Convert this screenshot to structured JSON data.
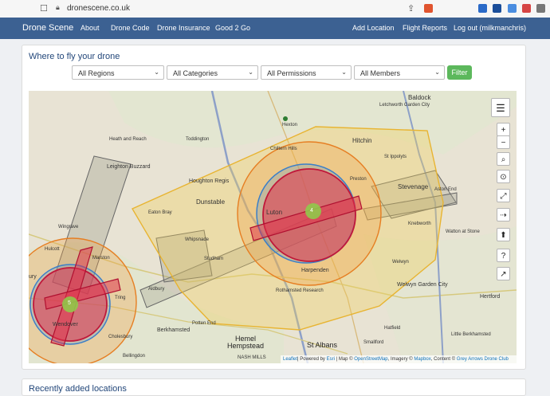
{
  "browser": {
    "url": "dronescene.co.uk",
    "icons": [
      "bookmark-icon",
      "lock-icon",
      "share-icon",
      "brave-shield-icon"
    ]
  },
  "nav": {
    "brand": "Drone Scene",
    "left_items": [
      "About",
      "Drone Code",
      "Drone Insurance",
      "Good 2 Go"
    ],
    "right_items": [
      "Add Location",
      "Flight Reports",
      "Log out (milkmanchris)"
    ],
    "bg_color": "#3c6192"
  },
  "page": {
    "title": "Where to fly your drone",
    "filters": {
      "regions": "All Regions",
      "categories": "All Categories",
      "permissions": "All Permissions",
      "members": "All Members",
      "button": "Filter"
    },
    "recent_heading": "Recently added locations"
  },
  "map": {
    "places": {
      "baldock": "Baldock",
      "letchworth": "Letchworth Garden City",
      "hexton": "Hexton",
      "heath": "Heath and Reach",
      "toddington": "Toddington",
      "chiltern": "Chiltern Hills",
      "hitchin": "Hitchin",
      "ippolyts": "St Ippolyts",
      "leighton": "Leighton Buzzard",
      "houghton": "Houghton Regis",
      "eaton": "Eaton Bray",
      "dunstable": "Dunstable",
      "luton": "Luton",
      "preston": "Preston",
      "stevenage": "Stevenage",
      "astonend": "Aston End",
      "wingrave": "Wingrave",
      "whipsnade": "Whipsnade",
      "studham": "Studham",
      "knebworth": "Knebworth",
      "watton": "Watton at Stone",
      "hulcott": "Hulcott",
      "marston": "Marston",
      "harpenden": "Harpenden",
      "welwyn": "Welwyn",
      "welwyngc": "Welwyn Garden City",
      "tring": "Tring",
      "rothamsted": "Rothamsted Research",
      "aldbury": "Aldbury",
      "hertford": "Hertford",
      "wendover": "Wendover",
      "berkhamsted": "Berkhamsted",
      "potten": "Potten End",
      "hatfield": "Hatfield",
      "cholesbury": "Cholesbury",
      "hemel": "Hemel Hempstead",
      "stalbans": "St Albans",
      "berkhamsted2": "Little Berkhamsted",
      "bellingdon": "Bellingdon",
      "smallford": "Smallford",
      "nash": "NASH MILLS",
      "ury": "ury"
    },
    "clusters": [
      "4",
      "5"
    ],
    "attribution": {
      "leaflet": "Leaflet",
      "powered": "| Powered by ",
      "esri": "Esri",
      "mapsep": " | Map © ",
      "osm": "OpenStreetMap",
      "imagery": ", Imagery © ",
      "mapbox": "Mapbox",
      "content": ", Content © ",
      "club": "Grey Arrows Drone Club"
    },
    "controls": [
      "layers-icon",
      "zoom-in",
      "zoom-out",
      "search-icon",
      "locate-pin-icon",
      "fullscreen-icon",
      "measure-icon",
      "upload-icon",
      "help-icon",
      "share-icon"
    ],
    "zoom_in": "+",
    "zoom_out": "−"
  }
}
